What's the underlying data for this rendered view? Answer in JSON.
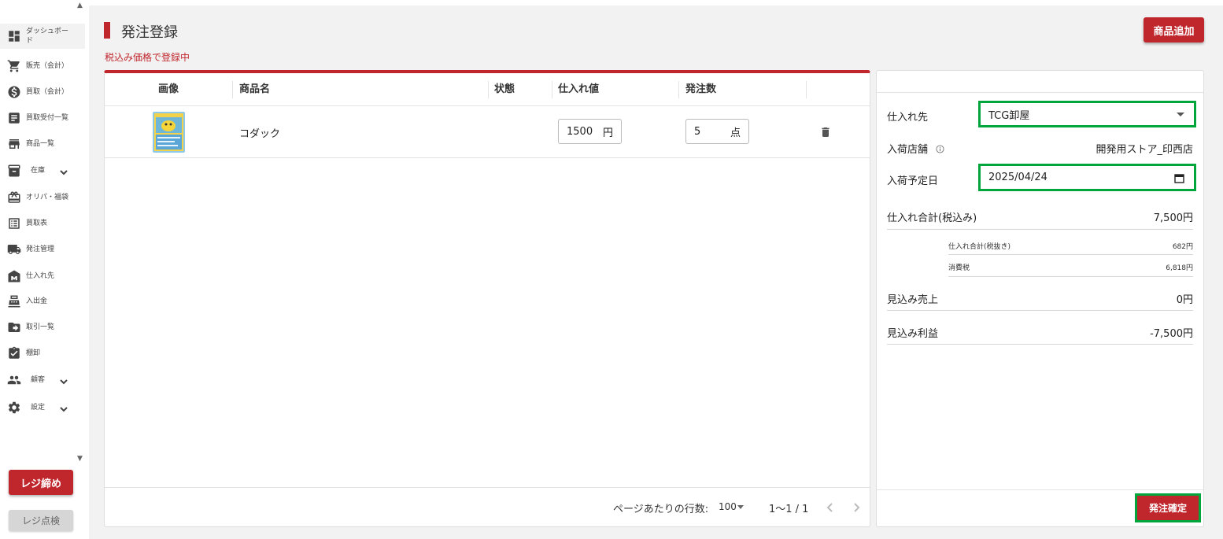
{
  "sidebar": {
    "items": [
      {
        "label": "ダッシュボード",
        "icon": "dashboard-icon"
      },
      {
        "label": "販売（会計）",
        "icon": "cart-icon"
      },
      {
        "label": "買取（会計）",
        "icon": "dollar-icon"
      },
      {
        "label": "買取受付一覧",
        "icon": "receipt-icon"
      },
      {
        "label": "商品一覧",
        "icon": "store-icon"
      },
      {
        "label": "在庫",
        "icon": "archive-icon"
      },
      {
        "label": "オリパ・福袋",
        "icon": "gift-icon"
      },
      {
        "label": "買取表",
        "icon": "list-icon"
      },
      {
        "label": "発注管理",
        "icon": "truck-icon"
      },
      {
        "label": "仕入れ先",
        "icon": "warehouse-icon"
      },
      {
        "label": "入出金",
        "icon": "register-icon"
      },
      {
        "label": "取引一覧",
        "icon": "transaction-icon"
      },
      {
        "label": "棚卸",
        "icon": "clipboard-check-icon"
      },
      {
        "label": "顧客",
        "icon": "people-icon"
      },
      {
        "label": "設定",
        "icon": "gear-icon"
      }
    ],
    "close_register": "レジ締め",
    "check_register": "レジ点検"
  },
  "header": {
    "title": "発注登録",
    "tax_note": "税込み価格で登録中",
    "add_product": "商品追加"
  },
  "table": {
    "columns": [
      "画像",
      "商品名",
      "状態",
      "仕入れ値",
      "発注数"
    ],
    "rows": [
      {
        "name": "コダック",
        "condition": "",
        "price": "1500",
        "price_unit": "円",
        "qty": "5",
        "qty_unit": "点"
      }
    ],
    "footer": {
      "rows_per_page_label": "ページあたりの行数:",
      "rows_per_page": "100",
      "page_info": "1〜1 / 1"
    }
  },
  "summary": {
    "supplier_label": "仕入れ先",
    "supplier_value": "TCG卸屋",
    "store_label": "入荷店舗",
    "store_value": "開発用ストア_印西店",
    "date_label": "入荷予定日",
    "date_value": "2025/04/24",
    "total_label": "仕入れ合計(税込み)",
    "total_value": "7,500円",
    "excl_label": "仕入れ合計(税抜き)",
    "excl_value": "682円",
    "tax_label": "消費税",
    "tax_value": "6,818円",
    "sales_label": "見込み売上",
    "sales_value": "0円",
    "profit_label": "見込み利益",
    "profit_value": "-7,500円",
    "confirm": "発注確定"
  },
  "colors": {
    "accent": "#c0272d",
    "highlight": "#00a63b"
  }
}
